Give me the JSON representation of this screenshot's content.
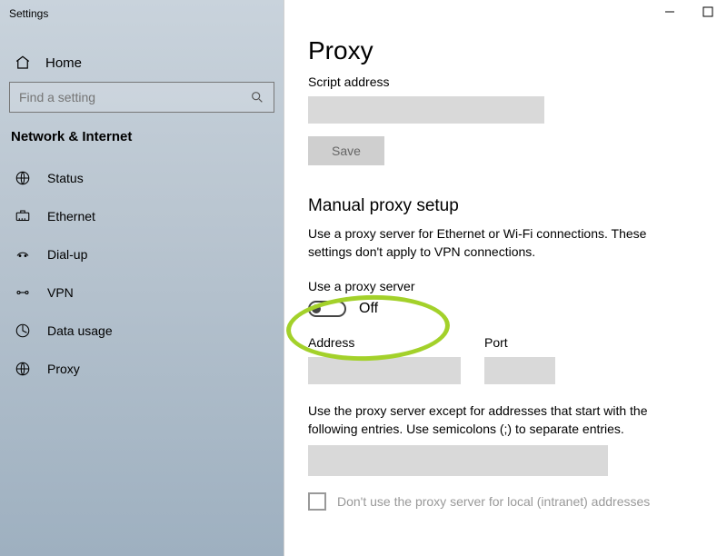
{
  "window": {
    "title": "Settings"
  },
  "sidebar": {
    "home": "Home",
    "search_placeholder": "Find a setting",
    "section": "Network & Internet",
    "items": [
      {
        "label": "Status",
        "icon": "globe-icon"
      },
      {
        "label": "Ethernet",
        "icon": "ethernet-icon"
      },
      {
        "label": "Dial-up",
        "icon": "dialup-icon"
      },
      {
        "label": "VPN",
        "icon": "vpn-icon"
      },
      {
        "label": "Data usage",
        "icon": "data-usage-icon"
      },
      {
        "label": "Proxy",
        "icon": "proxy-icon"
      }
    ]
  },
  "main": {
    "title": "Proxy",
    "script_address_label": "Script address",
    "script_address_value": "",
    "save_label": "Save",
    "manual_header": "Manual proxy setup",
    "manual_desc": "Use a proxy server for Ethernet or Wi-Fi connections. These settings don't apply to VPN connections.",
    "use_proxy_label": "Use a proxy server",
    "toggle_state": "Off",
    "address_label": "Address",
    "address_value": "",
    "port_label": "Port",
    "port_value": "",
    "exceptions_desc": "Use the proxy server except for addresses that start with the following entries. Use semicolons (;) to separate entries.",
    "exceptions_value": "",
    "bypass_local_label": "Don't use the proxy server for local (intranet) addresses"
  },
  "colors": {
    "highlight": "#a3d12a"
  }
}
